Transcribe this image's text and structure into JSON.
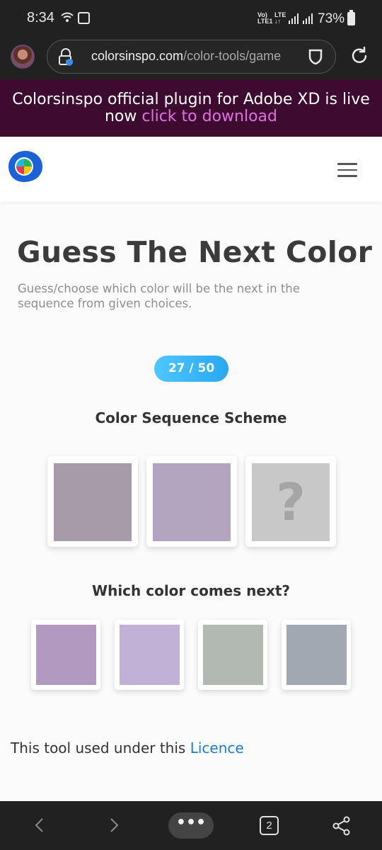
{
  "status_bar": {
    "time": "8:34",
    "network_top": "Vo)",
    "network_bottom": "LTE1",
    "lte_top": "LTE",
    "lte_bottom": "↓↑",
    "battery": "73%"
  },
  "browser": {
    "url_domain": "colorsinspo.com",
    "url_path": "/color-tools/game",
    "icons": [
      "profile-avatar",
      "lock-icon",
      "shield-icon",
      "reload-icon"
    ]
  },
  "banner": {
    "text": "Colorsinspo official plugin for Adobe XD is live now",
    "link": "click to download"
  },
  "page": {
    "title": "Guess The Next Color",
    "description": "Guess/choose which color will be the next in the sequence from given choices.",
    "counter": "27 / 50",
    "sequence_heading": "Color Sequence Scheme",
    "sequence": [
      {
        "color": "#a69ba9"
      },
      {
        "color": "#b3a4bf"
      },
      {
        "color": "#c8c8c8",
        "unknown": true,
        "symbol": "?"
      }
    ],
    "question": "Which color comes next?",
    "options": [
      {
        "color": "#b299bf"
      },
      {
        "color": "#c1b1d6"
      },
      {
        "color": "#b2b8b2"
      },
      {
        "color": "#a2a8b2"
      }
    ],
    "licence_text": "This tool used under this",
    "licence_link": "Licence"
  },
  "bottom_nav": {
    "menu": "•••",
    "tab_count": "2",
    "icons": [
      "back-icon",
      "forward-icon",
      "menu-icon",
      "tabs-icon",
      "share-icon"
    ]
  },
  "colors": {
    "banner_bg": "#3d0b2f",
    "banner_link": "#e070e0",
    "counter_accent": "#28a8f0",
    "link": "#1a7fc9"
  }
}
